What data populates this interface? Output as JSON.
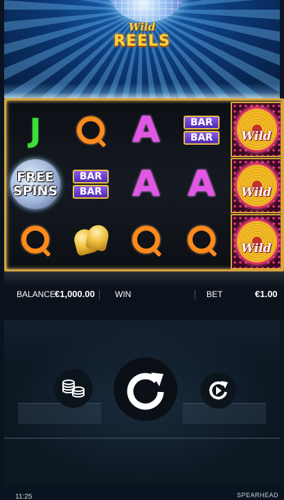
{
  "game": {
    "logo_line1": "Wild",
    "logo_line2": "REELS",
    "brand": "SPEARHEAD",
    "clock": "11:25"
  },
  "reels": {
    "rows": [
      [
        "J",
        "Q",
        "A",
        "BAR BAR"
      ],
      [
        "FREE SPINS",
        "BAR BAR",
        "A",
        "A"
      ],
      [
        "Q",
        "bells",
        "Q",
        "Q"
      ]
    ],
    "bar_label": "BAR",
    "free_line1": "FREE",
    "free_line2": "SPINS",
    "wild_label": "Wild",
    "wild_column_count": 3
  },
  "info": {
    "balance_label": "BALANCE",
    "balance_value": "€1,000.00",
    "win_label": "WIN",
    "bet_label": "BET",
    "bet_value": "€1.00"
  },
  "controls": {
    "coins_icon": "coins-icon",
    "spin_icon": "spin-arrow-icon",
    "autoplay_icon": "autoplay-icon",
    "menu_icon": "hamburger-menu-icon"
  },
  "colors": {
    "frame_gold": "#d8a53a",
    "j_green": "#3fdc3a",
    "q_orange": "#ff8a1c",
    "a_magenta": "#e256e6",
    "bar_purple": "#6a45d6",
    "wild_pink": "#e0306a"
  }
}
